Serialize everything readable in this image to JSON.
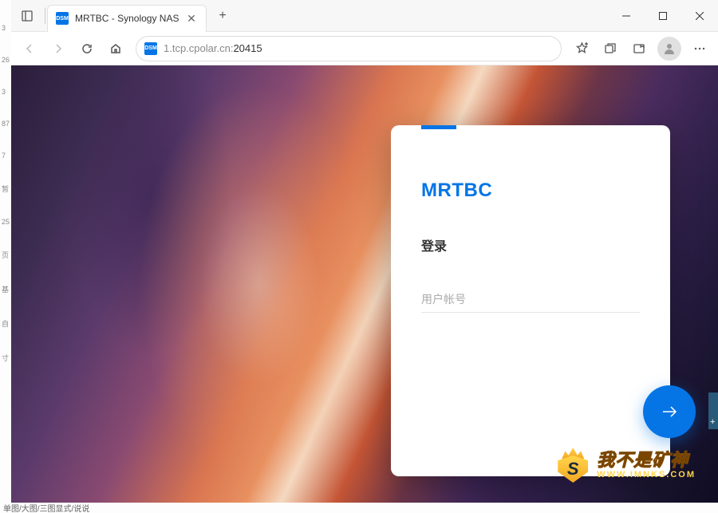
{
  "browser": {
    "tab": {
      "favicon_text": "DSM",
      "title": "MRTBC - Synology NAS"
    },
    "url": {
      "favicon_text": "DSM",
      "host": "1.tcp.cpolar.cn:",
      "port": "20415"
    }
  },
  "login": {
    "brand": "MRTBC",
    "heading": "登录",
    "username_placeholder": "用户帐号"
  },
  "watermark": {
    "shield_letter": "S",
    "cn_text": "我不是矿神",
    "url_text": "WWW.IMNKS.COM"
  },
  "gutter": [
    "3",
    "26",
    "3",
    "87",
    "7",
    "暂",
    "25",
    "页",
    "",
    "基",
    "自",
    "寸"
  ],
  "bottom_text": "单图/大图/三图显式/说说"
}
